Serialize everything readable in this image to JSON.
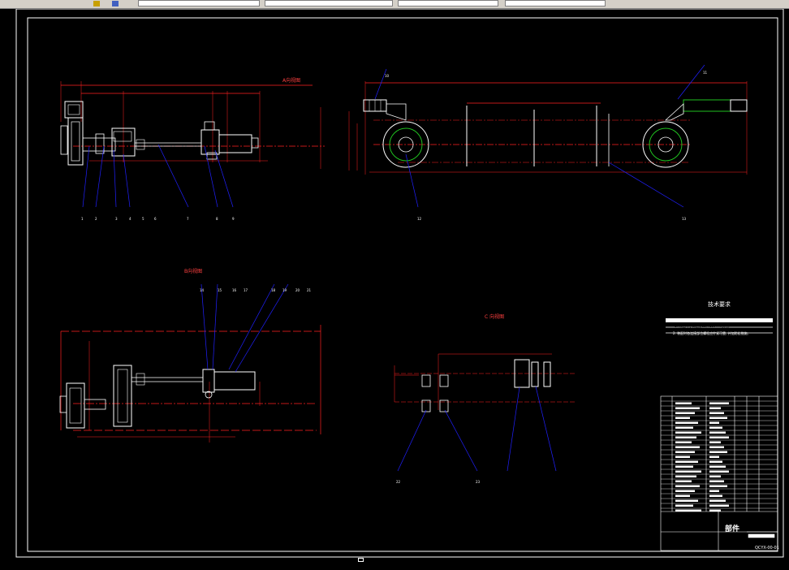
{
  "app": {
    "toolbar_fields": [
      "",
      "",
      "",
      "",
      "",
      "",
      ""
    ]
  },
  "drawing": {
    "tech_requirements_title": "技术要求",
    "tech_note_1": "1. 未注尺寸公差按GB/T1804-m执行;",
    "tech_note_2": "2. 装配时各连接部位螺栓应拧紧可靠, 并加防松措施;",
    "title_block_name": "部件",
    "drawing_code": "QCYX-00-01",
    "view_label_top_left": "A向视图",
    "view_label_mid_left": "B向视图",
    "view_label_mid_right": "C 向视图",
    "balloon_labels": [
      "1",
      "2",
      "3",
      "4",
      "5",
      "6",
      "7",
      "8",
      "9",
      "10",
      "11",
      "12",
      "13",
      "14",
      "15",
      "16",
      "17",
      "18",
      "19",
      "20",
      "21",
      "22",
      "23"
    ]
  },
  "colors": {
    "background": "#000000",
    "outline": "#ffffff",
    "dimension": "#ff2020",
    "leader": "#2020ff",
    "centerline": "#ff0000",
    "accent_green": "#20c020",
    "toolbar": "#d4d0c8"
  }
}
